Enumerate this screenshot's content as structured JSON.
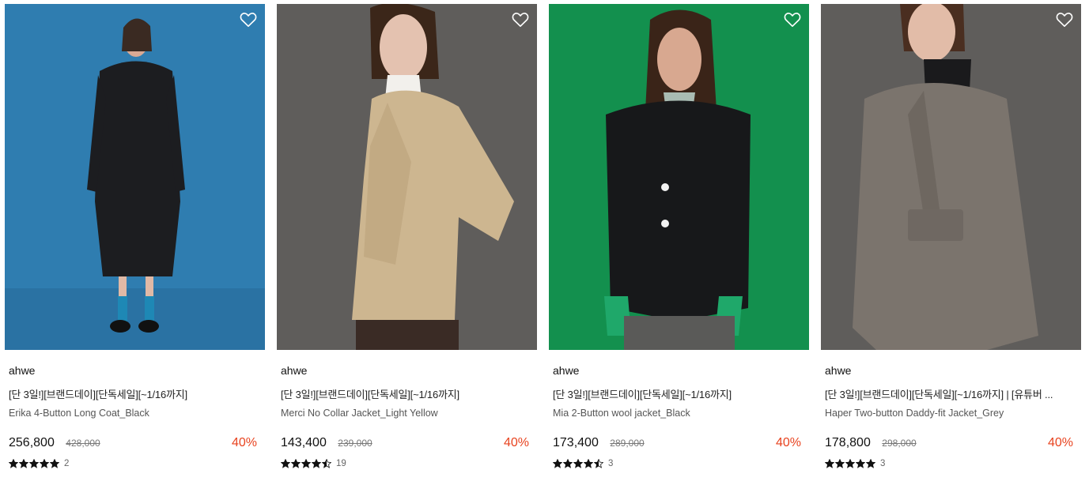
{
  "products": [
    {
      "brand": "ahwe",
      "promo": "[단 3일!][브랜드데이][단독세일][~1/16까지]",
      "name": "Erika 4-Button Long Coat_Black",
      "price": "256,800",
      "original_price": "428,000",
      "discount": "40%",
      "rating": 5,
      "review_count": "2",
      "bg_color": "#2e7cae",
      "garment_color": "#1b1c1f"
    },
    {
      "brand": "ahwe",
      "promo": "[단 3일!][브랜드데이][단독세일][~1/16까지]",
      "name": "Merci No Collar Jacket_Light Yellow",
      "price": "143,400",
      "original_price": "239,000",
      "discount": "40%",
      "rating": 4.5,
      "review_count": "19",
      "bg_color": "#5e5c5a",
      "garment_color": "#cdb690"
    },
    {
      "brand": "ahwe",
      "promo": "[단 3일!][브랜드데이][단독세일][~1/16까지]",
      "name": "Mia 2-Button wool jacket_Black",
      "price": "173,400",
      "original_price": "289,000",
      "discount": "40%",
      "rating": 4.5,
      "review_count": "3",
      "bg_color": "#13904e",
      "garment_color": "#161718"
    },
    {
      "brand": "ahwe",
      "promo": "[단 3일!][브랜드데이][단독세일][~1/16까지] | [유튜버 ...",
      "name": "Haper Two-button Daddy-fit Jacket_Grey",
      "price": "178,800",
      "original_price": "298,000",
      "discount": "40%",
      "rating": 5,
      "review_count": "3",
      "bg_color": "#5f5d5b",
      "garment_color": "#7b746d"
    }
  ],
  "icons": {
    "wishlist": "heart-outline-icon",
    "star": "star-icon"
  },
  "colors": {
    "discount": "#e8431f",
    "text": "#222222",
    "muted": "#777777"
  }
}
